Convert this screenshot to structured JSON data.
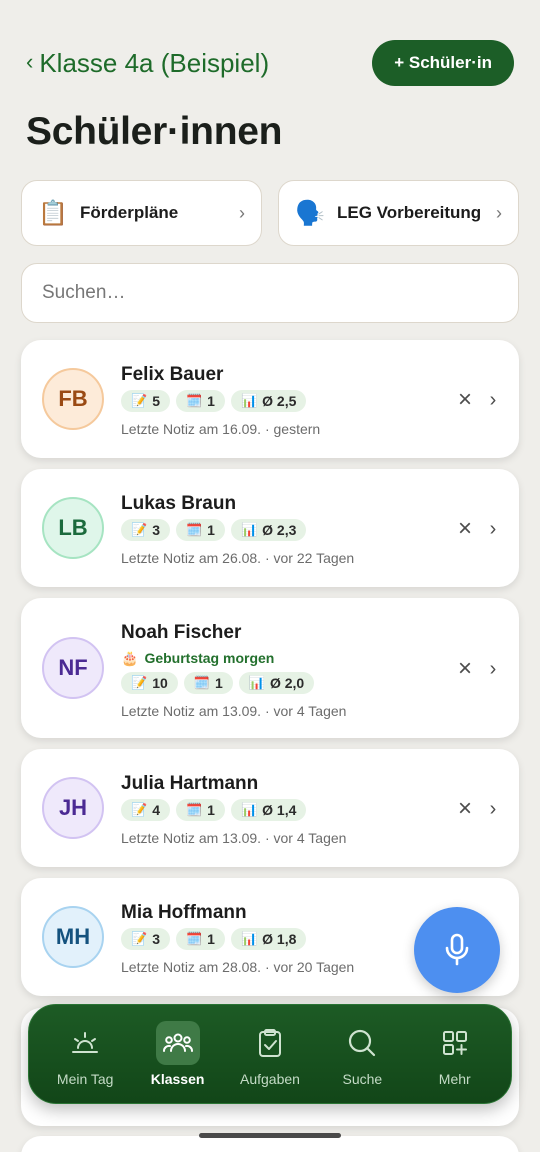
{
  "header": {
    "back_label": "Klasse 4a (Beispiel)",
    "add_button_label": "+ Schüler·in"
  },
  "page_title": "Schüler·innen",
  "quick_actions": [
    {
      "emoji": "📋",
      "label": "Förderpläne",
      "icon": "clipboard-icon"
    },
    {
      "emoji": "🗣️",
      "label": "LEG Vorbereitung",
      "icon": "speaking-head-icon"
    }
  ],
  "search": {
    "placeholder": "Suchen…",
    "value": ""
  },
  "students": [
    {
      "initials": "FB",
      "name": "Felix Bauer",
      "notes": "5",
      "dates": "1",
      "avg": "Ø 2,5",
      "birthday": "",
      "meta": "Letzte Notiz am 16.09. · gestern",
      "avatar_bg": "#fdebd9",
      "avatar_border": "#f5c99c",
      "avatar_color": "#9a4a14"
    },
    {
      "initials": "LB",
      "name": "Lukas Braun",
      "notes": "3",
      "dates": "1",
      "avg": "Ø 2,3",
      "birthday": "",
      "meta": "Letzte Notiz am 26.08. · vor 22 Tagen",
      "avatar_bg": "#dff6ea",
      "avatar_border": "#a6e4c2",
      "avatar_color": "#1b6b3d"
    },
    {
      "initials": "NF",
      "name": "Noah Fischer",
      "notes": "10",
      "dates": "1",
      "avg": "Ø 2,0",
      "birthday": "Geburtstag morgen",
      "meta": "Letzte Notiz am 13.09. · vor 4 Tagen",
      "avatar_bg": "#efe9fb",
      "avatar_border": "#d2c3f2",
      "avatar_color": "#4b2a93"
    },
    {
      "initials": "JH",
      "name": "Julia Hartmann",
      "notes": "4",
      "dates": "1",
      "avg": "Ø 1,4",
      "birthday": "",
      "meta": "Letzte Notiz am 13.09. · vor 4 Tagen",
      "avatar_bg": "#efe9fb",
      "avatar_border": "#d2c3f2",
      "avatar_color": "#4b2a93"
    },
    {
      "initials": "MH",
      "name": "Mia Hoffmann",
      "notes": "3",
      "dates": "1",
      "avg": "Ø 1,8",
      "birthday": "",
      "meta": "Letzte Notiz am 28.08. · vor 20 Tagen",
      "avatar_bg": "#e2f1fb",
      "avatar_border": "#a8d3f0",
      "avatar_color": "#14527e"
    }
  ],
  "badge_icons": {
    "notes": "📝",
    "dates": "🗓️",
    "avg": "📊",
    "birthday": "🎂"
  },
  "nav": [
    {
      "label": "Mein Tag",
      "icon": "sunrise-icon",
      "active": false
    },
    {
      "label": "Klassen",
      "icon": "people-icon",
      "active": true
    },
    {
      "label": "Aufgaben",
      "icon": "clipboard-check-icon",
      "active": false
    },
    {
      "label": "Suche",
      "icon": "search-icon",
      "active": false
    },
    {
      "label": "Mehr",
      "icon": "grid-plus-icon",
      "active": false
    }
  ],
  "colors": {
    "brand_green": "#1c5e27",
    "mic_blue": "#4d8ff0",
    "background": "#efeeea"
  }
}
